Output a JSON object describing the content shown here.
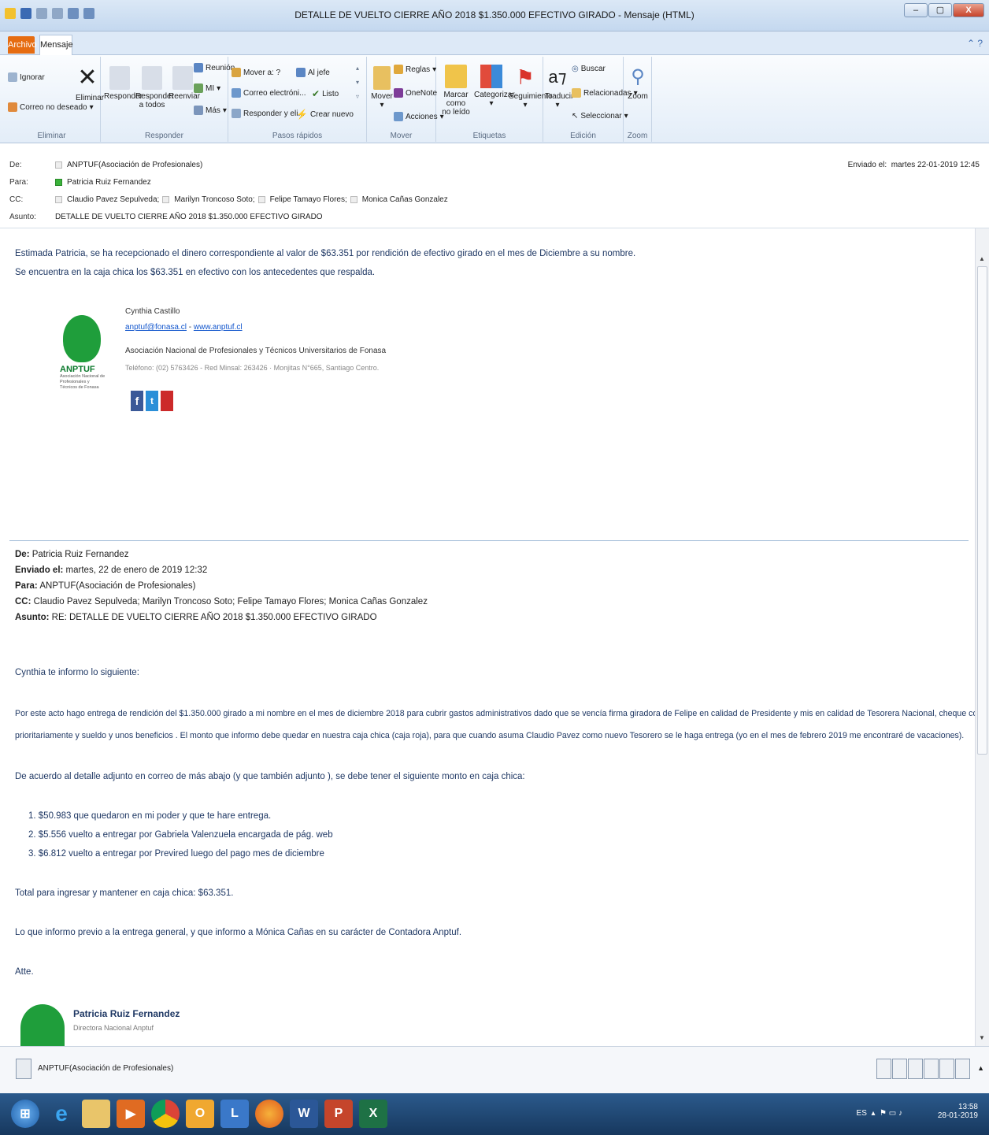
{
  "window": {
    "title": "DETALLE DE VUELTO CIERRE AÑO 2018 $1.350.000 EFECTIVO GIRADO - Mensaje (HTML)",
    "min": "–",
    "max": "▢",
    "close": "X"
  },
  "tabs": {
    "archivo": "Archivo",
    "mensaje": "Mensaje"
  },
  "ribbon": {
    "eliminar": {
      "ignorar": "Ignorar",
      "correo_no_deseado": "Correo no deseado",
      "eliminar_btn": "Eliminar",
      "label": "Eliminar"
    },
    "responder": {
      "responder": "Responder",
      "responder_todos_1": "Responder",
      "responder_todos_2": "a todos",
      "reenviar": "Reenviar",
      "reunion": "Reunión",
      "mi": "MI",
      "mas": "Más",
      "label": "Responder"
    },
    "pasos": {
      "mover_a": "Mover a: ?",
      "al_jefe": "Al jefe",
      "correo_electronico": "Correo electróni...",
      "listo": "Listo",
      "responder_eli": "Responder y eli...",
      "crear_nuevo": "Crear nuevo",
      "label": "Pasos rápidos"
    },
    "mover": {
      "mover": "Mover",
      "reglas": "Reglas",
      "onenote": "OneNote",
      "acciones": "Acciones",
      "label": "Mover"
    },
    "etiquetas": {
      "marcar_1": "Marcar como",
      "marcar_2": "no leído",
      "categorizar": "Categorizar",
      "seguimiento": "Seguimiento",
      "label": "Etiquetas"
    },
    "edicion": {
      "traducir": "Traducir",
      "buscar": "Buscar",
      "relacionadas": "Relacionadas",
      "seleccionar": "Seleccionar",
      "label": "Edición"
    },
    "zoom": {
      "zoom": "Zoom",
      "label": "Zoom"
    }
  },
  "header": {
    "de_label": "De:",
    "de_value": "ANPTUF(Asociación de Profesionales)",
    "para_label": "Para:",
    "para_value": "Patricia Ruiz Fernandez",
    "cc_label": "CC:",
    "cc": [
      "Claudio Pavez Sepulveda;",
      "Marilyn Troncoso Soto;",
      "Felipe Tamayo Flores;",
      "Monica Cañas Gonzalez"
    ],
    "asunto_label": "Asunto:",
    "asunto_value": "DETALLE DE VUELTO CIERRE AÑO 2018 $1.350.000 EFECTIVO GIRADO",
    "enviado_label": "Enviado el:",
    "enviado_value": "martes 22-01-2019 12:45"
  },
  "body": {
    "line1": "Estimada Patricia, se ha recepcionado el dinero correspondiente al valor de $63.351 por rendición de efectivo girado en el mes de Diciembre a su nombre.",
    "line2": "Se encuentra en la caja chica los $63.351 en efectivo con los antecedentes que respalda.",
    "sig1": {
      "name": "Cynthia Castillo",
      "email": "anptuf@fonasa.cl",
      "sep": " - ",
      "web": "www.anptuf.cl",
      "org": "Asociación Nacional de Profesionales y Técnicos Universitarios de Fonasa",
      "phone": "Teléfono: (02) 5763426 - Red Minsal: 263426 · Monjitas N°665, Santiago Centro.",
      "logo_text": "ANPTUF",
      "logo_sub": "Asociación Nacional de Profesionales y Técnicos de Fonasa"
    },
    "fw": {
      "de_label": "De:",
      "de": " Patricia Ruiz Fernandez",
      "enviado_label": "Enviado el:",
      "enviado": " martes, 22 de enero de 2019 12:32",
      "para_label": "Para:",
      "para": " ANPTUF(Asociación de Profesionales)",
      "cc_label": "CC:",
      "cc": " Claudio Pavez Sepulveda; Marilyn Troncoso Soto; Felipe Tamayo Flores; Monica Cañas Gonzalez",
      "asunto_label": "Asunto:",
      "asunto": " RE: DETALLE DE VUELTO CIERRE AÑO 2018 $1.350.000 EFECTIVO GIRADO"
    },
    "p1": "Cynthia te informo lo siguiente:",
    "p2a": "Por este acto hago entrega de rendición del $1.350.000 girado a mi nombre en el mes de diciembre 2018 para cubrir gastos administrativos dado que se vencía firma giradora de Felipe en calidad de Presidente y mis en calidad de Tesorera Nacional, cheque cobrado para tener efectivo para pagar",
    "p2b": "prioritariamente y sueldo y unos beneficios .  El monto que informo debe quedar en nuestra caja chica (caja roja), para que cuando asuma Claudio Pavez como nuevo Tesorero se le haga entrega (yo en el mes de febrero 2019 me encontraré de vacaciones).",
    "p3": "De acuerdo al detalle adjunto en correo de más abajo (y que también adjunto ), se debe tener el siguiente monto en caja chica:",
    "list": [
      "1.   $50.983 que quedaron en mi poder y que te hare entrega.",
      "2.   $5.556 vuelto a entregar por Gabriela Valenzuela encargada de pág. web",
      "3.   $6.812 vuelto a entregar por Previred luego del pago mes de diciembre"
    ],
    "p4": "Total para ingresar y mantener en caja chica: $63.351.",
    "p5": "Lo que informo previo a la entrega general, y que informo a Mónica Cañas en su carácter de Contadora Anptuf.",
    "p6": "Atte.",
    "sig2_name": "Patricia Ruiz Fernandez",
    "sig2_title": "Directora Nacional Anptuf"
  },
  "people": {
    "name": "ANPTUF(Asociación de Profesionales)"
  },
  "taskbar": {
    "lang": "ES",
    "time": "13:58",
    "date": "28-01-2019"
  },
  "colors": {
    "accent": "#e66c11",
    "link": "#1155cc",
    "logo_green": "#1f9e3b"
  }
}
